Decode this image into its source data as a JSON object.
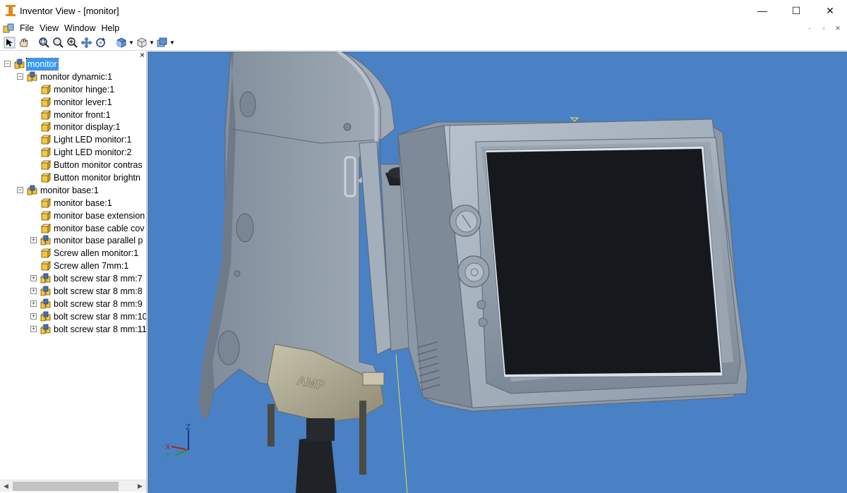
{
  "window": {
    "title": "Inventor View - [monitor]",
    "minimize": "—",
    "maximize": "☐",
    "close": "✕"
  },
  "menu": {
    "items": [
      "File",
      "View",
      "Window",
      "Help"
    ],
    "mdi": {
      "minimize": "-",
      "restore": "▫",
      "close": "✕"
    }
  },
  "toolbar": {
    "buttons": [
      "select-icon",
      "pan-icon",
      "zoom-window-icon",
      "zoom-icon",
      "zoom-fit-icon",
      "move-icon",
      "rotate-icon",
      "view-cube-icon",
      "section-icon",
      "display-mode-icon"
    ]
  },
  "tree": {
    "close": "×",
    "nodes": [
      {
        "label": "monitor",
        "level": 0,
        "type": "assembly",
        "expander": "−",
        "selected": true
      },
      {
        "label": "monitor dynamic:1",
        "level": 1,
        "type": "assembly",
        "expander": "−"
      },
      {
        "label": "monitor hinge:1",
        "level": 2,
        "type": "part"
      },
      {
        "label": "monitor lever:1",
        "level": 2,
        "type": "part"
      },
      {
        "label": "monitor front:1",
        "level": 2,
        "type": "part"
      },
      {
        "label": "monitor display:1",
        "level": 2,
        "type": "part"
      },
      {
        "label": "Light LED monitor:1",
        "level": 2,
        "type": "part"
      },
      {
        "label": "Light LED monitor:2",
        "level": 2,
        "type": "part"
      },
      {
        "label": "Button monitor contras",
        "level": 2,
        "type": "part"
      },
      {
        "label": "Button monitor brightn",
        "level": 2,
        "type": "part"
      },
      {
        "label": "monitor base:1",
        "level": 1,
        "type": "assembly",
        "expander": "−"
      },
      {
        "label": "monitor base:1",
        "level": 2,
        "type": "part"
      },
      {
        "label": "monitor base extension",
        "level": 2,
        "type": "part"
      },
      {
        "label": "monitor base cable cov",
        "level": 2,
        "type": "part"
      },
      {
        "label": "monitor base parallel p",
        "level": 2,
        "type": "assembly",
        "expander": "+"
      },
      {
        "label": "Screw allen monitor:1",
        "level": 2,
        "type": "part"
      },
      {
        "label": "Screw allen 7mm:1",
        "level": 2,
        "type": "part"
      },
      {
        "label": "bolt screw star 8 mm:7",
        "level": 2,
        "type": "assembly",
        "expander": "+"
      },
      {
        "label": "bolt screw star 8 mm:8",
        "level": 2,
        "type": "assembly",
        "expander": "+"
      },
      {
        "label": "bolt screw star 8 mm:9",
        "level": 2,
        "type": "assembly",
        "expander": "+"
      },
      {
        "label": "bolt screw star 8 mm:10",
        "level": 2,
        "type": "assembly",
        "expander": "+"
      },
      {
        "label": "bolt screw star 8 mm:11",
        "level": 2,
        "type": "assembly",
        "expander": "+"
      }
    ]
  },
  "viewport": {
    "background": "#4a80c4",
    "connector_text": "AMP",
    "axis": {
      "z": "Z",
      "x": "X",
      "y": "Y"
    }
  },
  "colors": {
    "selection": "#3399ff",
    "part_icon": "#f5c542",
    "body": "#8d9aa8",
    "screen": "#15181d"
  }
}
